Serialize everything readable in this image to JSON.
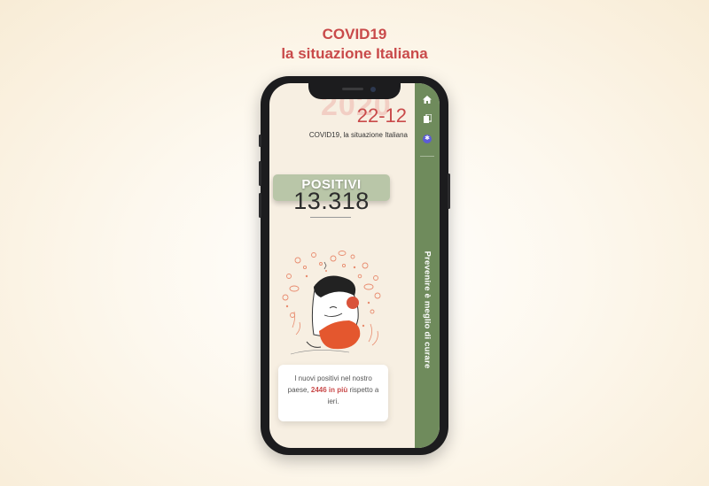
{
  "page": {
    "title_line1": "COVID19",
    "title_line2": "la situazione Italiana"
  },
  "app": {
    "year": "2020",
    "date": "22-12",
    "subtitle": "COVID19, la situazione Italiana",
    "stat_label": "POSITIVI",
    "stat_value": "13.318",
    "info_text_before": "I nuovi positivi nel nostro paese, ",
    "info_highlight": "2446 in più",
    "info_text_after": " rispetto a ieri."
  },
  "sidebar": {
    "icons": [
      "home-icon",
      "copy-icon",
      "accessibility-icon"
    ],
    "vertical_text": "Prevenire è meglio di curare"
  },
  "colors": {
    "accent": "#c94a4a",
    "sidebar": "#6f8b5c",
    "badge": "#b9c6a8",
    "screen_bg": "#f7efe2"
  }
}
